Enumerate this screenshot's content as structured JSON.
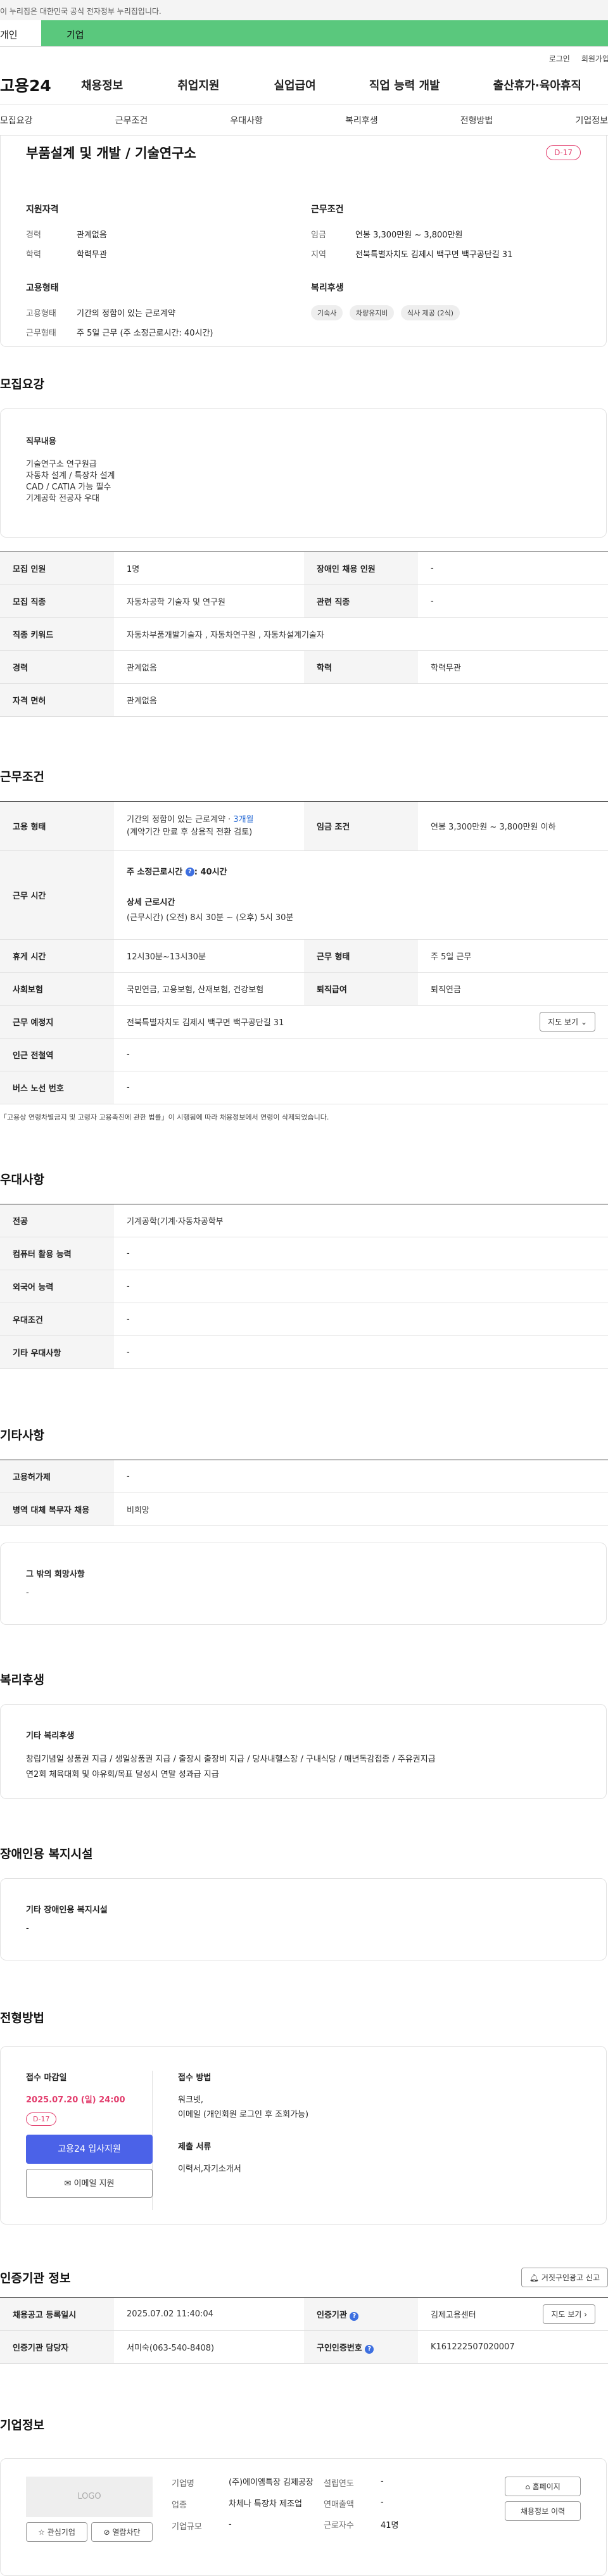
{
  "gov_banner": "이 누리집은 대한민국 공식 전자정부 누리집입니다.",
  "top_tabs": {
    "personal": "개인",
    "company": "기업"
  },
  "util": {
    "login": "로그인",
    "join": "회원가입"
  },
  "gnb": {
    "logo": "고용24",
    "menus": [
      "채용정보",
      "취업지원",
      "실업급여",
      "직업 능력 개발",
      "출산휴가·육아휴직"
    ]
  },
  "subtabs": [
    "모집요강",
    "근무조건",
    "우대사항",
    "복리후생",
    "전형방법",
    "기업정보"
  ],
  "summary": {
    "title": "부품설계 및 개발 / 기술연구소",
    "dday": "D-17",
    "qual_title": "지원자격",
    "career_label": "경력",
    "career_value": "관계없음",
    "edu_label": "학력",
    "edu_value": "학력무관",
    "work_title": "근무조건",
    "wage_label": "임금",
    "wage_value": "연봉 3,300만원 ~ 3,800만원",
    "region_label": "지역",
    "region_value": "전북특별자치도 김제시 백구면 백구공단길 31",
    "emp_title": "고용형태",
    "emptype_label": "고용형태",
    "emptype_value": "기간의 정함이 있는 근로계약",
    "worktype_label": "근무형태",
    "worktype_value": "주 5일 근무 (주 소정근로시간: 40시간)",
    "welfare_title": "복리후생",
    "welfare_chips": [
      "기숙사",
      "차량유지비",
      "식사 제공 (2식)"
    ]
  },
  "recruit": {
    "section_title": "모집요강",
    "duty_title": "직무내용",
    "duty_lines": [
      "기술연구소 연구원급",
      "자동차 설계 / 특장차 설계",
      "CAD / CATIA 가능 필수",
      "기계공학 전공자 우대"
    ],
    "rows": {
      "headcount_label": "모집 인원",
      "headcount_value": "1명",
      "disabled_label": "장애인 채용 인원",
      "disabled_value": "-",
      "job_label": "모집 직종",
      "job_value": "자동차공학 기술자 및 연구원",
      "related_label": "관련 직종",
      "related_value": "-",
      "keyword_label": "직종 키워드",
      "keyword_value": "자동차부품개발기술자 , 자동차연구원 , 자동차설계기술자",
      "career_label": "경력",
      "career_value": "관계없음",
      "edu_label": "학력",
      "edu_value": "학력무관",
      "license_label": "자격 면허",
      "license_value": "관계없음"
    }
  },
  "conditions": {
    "section_title": "근무조건",
    "emp_label": "고용 형태",
    "emp_value1": "기간의 정함이 있는 근로계약 · ",
    "emp_value_months": "3개월",
    "emp_value2": "(계약기간 만료 후 상용직 전환 검토)",
    "wage_label": "임금 조건",
    "wage_value": "연봉 3,300만원 ~ 3,800만원 이하",
    "hours_label": "근무 시간",
    "hours_week": "주 소정근로시간 ",
    "hours_week_value": ": 40시간",
    "hours_detail_title": "상세 근로시간",
    "hours_detail": "(근무시간) (오전) 8시 30분 ~ (오후) 5시 30분",
    "break_label": "휴게 시간",
    "break_value": "12시30분~13시30분",
    "worktype_label": "근무 형태",
    "worktype_value": "주 5일 근무",
    "insurance_label": "사회보험",
    "insurance_value": "국민연금, 고용보험, 산재보험, 건강보험",
    "severance_label": "퇴직급여",
    "severance_value": "퇴직연금",
    "place_label": "근무 예정지",
    "place_value": "전북특별자치도 김제시 백구면 백구공단길 31",
    "map_btn": "지도 보기",
    "subway_label": "인근 전철역",
    "subway_value": "-",
    "bus_label": "버스 노선 번호",
    "bus_value": "-",
    "note": "「고용상 연령차별금지 및 고령자 고용촉진에 관한 법률」이 시행됨에 따라 채용정보에서 연령이 삭제되었습니다."
  },
  "preference": {
    "section_title": "우대사항",
    "major_label": "전공",
    "major_value": "기계공학(기계·자동차공학부",
    "computer_label": "컴퓨터 활용 능력",
    "computer_value": "-",
    "lang_label": "외국어 능력",
    "lang_value": "-",
    "cond_label": "우대조건",
    "cond_value": "-",
    "etc_label": "기타 우대사항",
    "etc_value": "-"
  },
  "other": {
    "section_title": "기타사항",
    "employ_label": "고용허가제",
    "employ_value": "-",
    "military_label": "병역 대체 복무자 채용",
    "military_value": "비희망",
    "hope_title": "그 밖의 희망사항",
    "hope_value": "-"
  },
  "welfare": {
    "section_title": "복리후생",
    "box_title": "기타 복리후생",
    "line1": "창립기념일 상품권 지급 / 생일상품권 지급 / 출장시 출장비 지급 / 당사내헬스장 / 구내식당 / 매년독감접종 / 주유권지급",
    "line2": "연2회 체육대회 및 야유회/목표 달성시 연말 성과급 지급"
  },
  "disabled": {
    "section_title": "장애인용 복지시설",
    "box_title": "기타 장애인용 복지시설",
    "value": "-"
  },
  "selection": {
    "section_title": "전형방법",
    "deadline_title": "접수 마감일",
    "deadline_value": "2025.07.20 (일) 24:00",
    "dday": "D-17",
    "apply_btn": "고용24 입사지원",
    "email_btn": "이메일 지원",
    "method_title": "접수 방법",
    "method_value1": "워크넷,",
    "method_value2": "이메일 (개인회원 로그인 후 조회가능)",
    "docs_title": "제출 서류",
    "docs_value": "이력서,자기소개서"
  },
  "agency": {
    "section_title": "인증기관 정보",
    "report_btn": "거짓구인광고 신고",
    "reg_label": "채용공고 등록일시",
    "reg_value": "2025.07.02 11:40:04",
    "org_label": "인증기관",
    "org_value": "김제고용센터",
    "map_btn": "지도 보기",
    "manager_label": "인증기관 담당자",
    "manager_value": "서미숙(063-540-8408)",
    "reqno_label": "구인인증번호",
    "reqno_value": "K161222507020007"
  },
  "company": {
    "section_title": "기업정보",
    "logo_text": "LOGO",
    "fav_btn": "관심기업",
    "block_btn": "열람차단",
    "name_label": "기업명",
    "name_value": "(주)에이엠특장 김제공장",
    "industry_label": "업종",
    "industry_value": "차체나 특장차 제조업",
    "size_label": "기업규모",
    "size_value": "-",
    "founded_label": "설립연도",
    "founded_value": "-",
    "sales_label": "연매출액",
    "sales_value": "-",
    "employees_label": "근로자수",
    "employees_value": "41명",
    "homepage_btn": "홈페이지",
    "history_btn": "채용정보 이력"
  }
}
